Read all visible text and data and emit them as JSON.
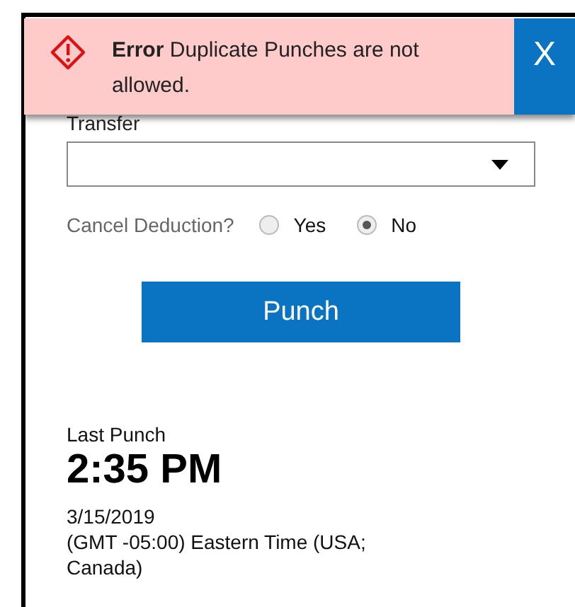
{
  "alert": {
    "title": "Error",
    "message": "Duplicate Punches are not allowed.",
    "close": "X"
  },
  "transfer": {
    "label": "Transfer"
  },
  "cancel_deduction": {
    "label": "Cancel Deduction?",
    "options": [
      {
        "label": "Yes",
        "selected": false
      },
      {
        "label": "No",
        "selected": true
      }
    ]
  },
  "punch_button": "Punch",
  "last_punch": {
    "label": "Last Punch",
    "time": "2:35 PM",
    "date": "3/15/2019",
    "timezone": "(GMT -05:00) Eastern Time (USA; Canada)"
  }
}
